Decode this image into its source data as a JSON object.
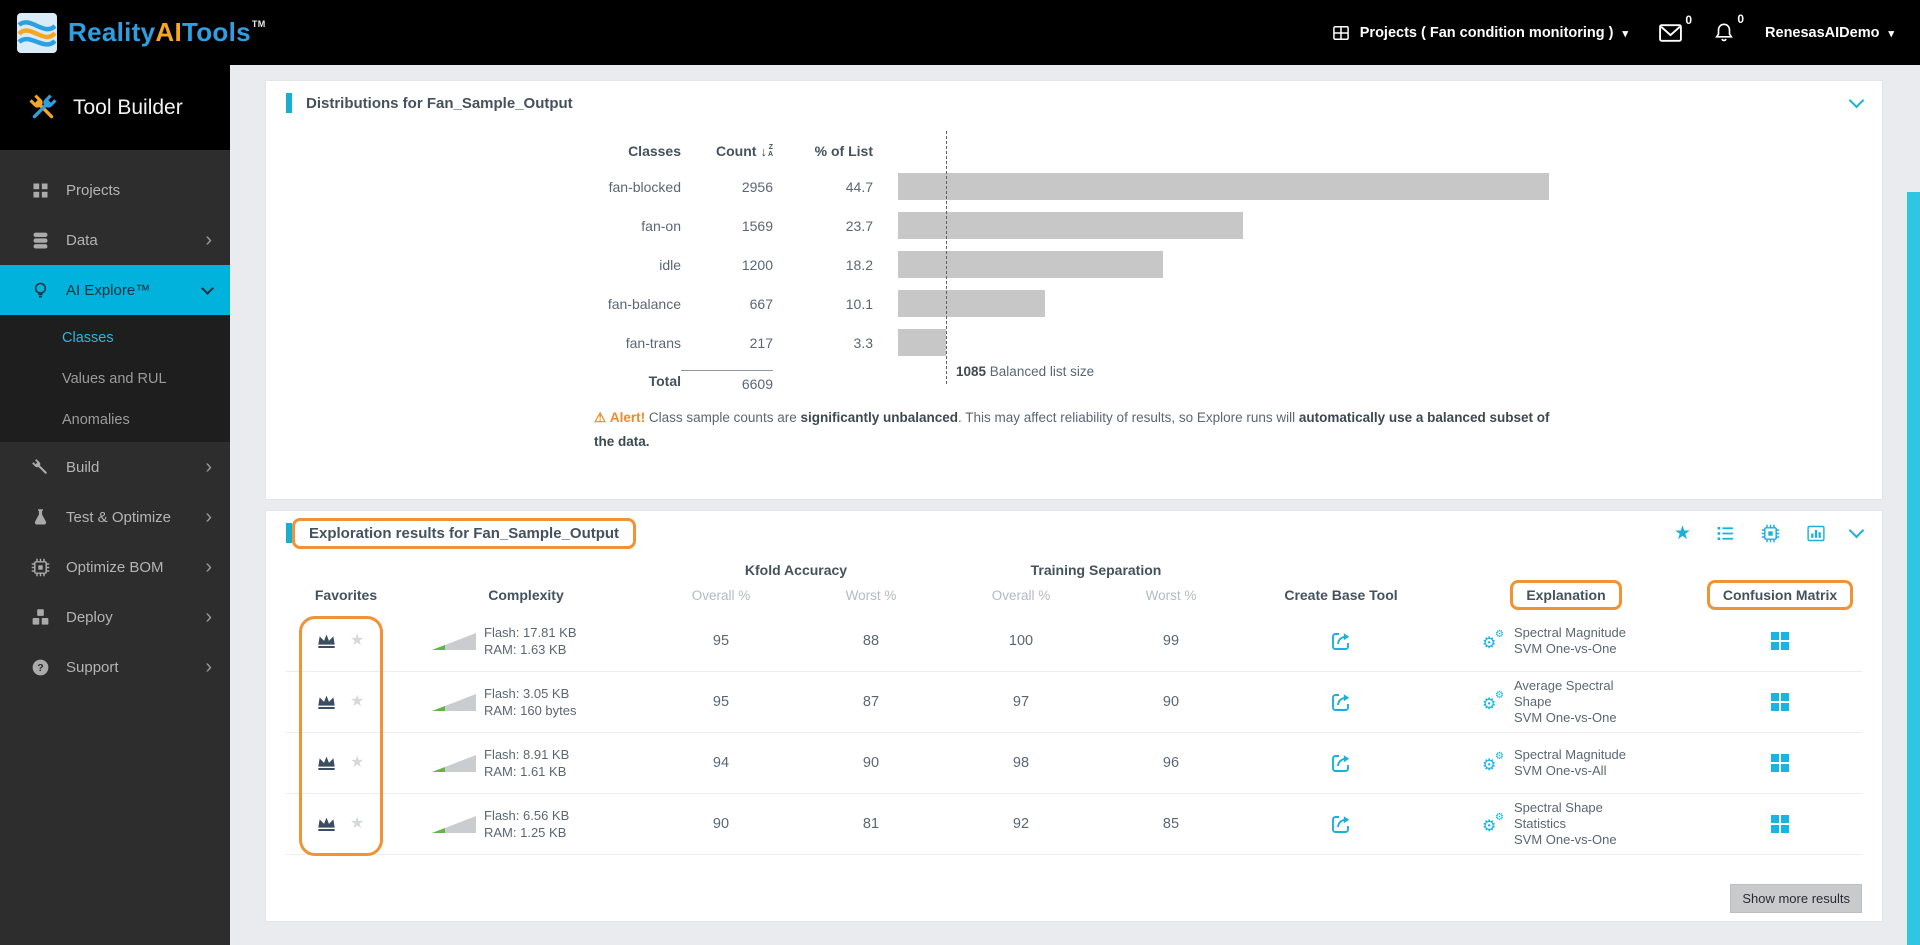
{
  "header": {
    "logo": {
      "part1": "Reality",
      "part2": "AI",
      "part3": "Tools",
      "tm": "TM"
    },
    "projects_label": "Projects ( Fan condition monitoring )",
    "mail_count": "0",
    "notifications_count": "0",
    "username": "RenesasAIDemo"
  },
  "sidebar": {
    "title": "Tool Builder",
    "items": [
      {
        "label": "Projects"
      },
      {
        "label": "Data"
      },
      {
        "label": "AI Explore™"
      },
      {
        "label": "Build"
      },
      {
        "label": "Test & Optimize"
      },
      {
        "label": "Optimize BOM"
      },
      {
        "label": "Deploy"
      },
      {
        "label": "Support"
      }
    ],
    "subitems": [
      {
        "label": "Classes"
      },
      {
        "label": "Values and RUL"
      },
      {
        "label": "Anomalies"
      }
    ]
  },
  "distributions": {
    "title": "Distributions for Fan_Sample_Output",
    "columns": {
      "classes": "Classes",
      "count": "Count",
      "pct": "% of List"
    },
    "rows": [
      {
        "cls": "fan-blocked",
        "count": "2956",
        "pct": "44.7"
      },
      {
        "cls": "fan-on",
        "count": "1569",
        "pct": "23.7"
      },
      {
        "cls": "idle",
        "count": "1200",
        "pct": "18.2"
      },
      {
        "cls": "fan-balance",
        "count": "667",
        "pct": "10.1"
      },
      {
        "cls": "fan-trans",
        "count": "217",
        "pct": "3.3"
      }
    ],
    "total_label": "Total",
    "total_count": "6609",
    "balanced_value": "1085",
    "balanced_label": " Balanced list size",
    "alert": {
      "label": "Alert!",
      "t1": " Class sample counts are ",
      "b1": "significantly unbalanced",
      "t2": ". This may affect reliability of results, so Explore runs will ",
      "b2": "automatically use a balanced subset of the data."
    }
  },
  "chart_data": {
    "type": "bar",
    "orientation": "horizontal",
    "categories": [
      "fan-blocked",
      "fan-on",
      "idle",
      "fan-balance",
      "fan-trans"
    ],
    "counts": [
      2956,
      1569,
      1200,
      667,
      217
    ],
    "values": [
      44.7,
      23.7,
      18.2,
      10.1,
      3.3
    ],
    "total": 6609,
    "balanced_list_size": 1085,
    "bar_color": "#c7c7c7",
    "marker_note": "dashed line at balanced per-class count (217)"
  },
  "exploration": {
    "title": "Exploration results for Fan_Sample_Output",
    "group_headers": {
      "kfold": "Kfold Accuracy",
      "separation": "Training Separation"
    },
    "columns": {
      "favorites": "Favorites",
      "complexity": "Complexity",
      "kfold_overall": "Overall %",
      "kfold_worst": "Worst %",
      "sep_overall": "Overall %",
      "sep_worst": "Worst %",
      "create": "Create Base Tool",
      "explanation": "Explanation",
      "confusion": "Confusion Matrix"
    },
    "rows": [
      {
        "flash": "Flash: 17.81 KB",
        "ram": "RAM: 1.63 KB",
        "kfold_overall": "95",
        "kfold_worst": "88",
        "sep_overall": "100",
        "sep_worst": "99",
        "features": "Spectral Magnitude",
        "model": "SVM One-vs-One"
      },
      {
        "flash": "Flash: 3.05 KB",
        "ram": "RAM: 160 bytes",
        "kfold_overall": "95",
        "kfold_worst": "87",
        "sep_overall": "97",
        "sep_worst": "90",
        "features": "Average Spectral Shape",
        "model": "SVM One-vs-One"
      },
      {
        "flash": "Flash: 8.91 KB",
        "ram": "RAM: 1.61 KB",
        "kfold_overall": "94",
        "kfold_worst": "90",
        "sep_overall": "98",
        "sep_worst": "96",
        "features": "Spectral Magnitude",
        "model": "SVM One-vs-All"
      },
      {
        "flash": "Flash: 6.56 KB",
        "ram": "RAM: 1.25 KB",
        "kfold_overall": "90",
        "kfold_worst": "81",
        "sep_overall": "92",
        "sep_worst": "85",
        "features": "Spectral Shape Statistics",
        "model": "SVM One-vs-One"
      }
    ],
    "show_more": "Show more results"
  },
  "glyphs": {
    "caret_down": "▾",
    "chevron_right": "›",
    "star": "★",
    "warning": "⚠",
    "gear_big": "⚙",
    "gear_small": "⚙",
    "sort_arrow": "↓",
    "sort_z": "Z",
    "sort_a": "A"
  }
}
